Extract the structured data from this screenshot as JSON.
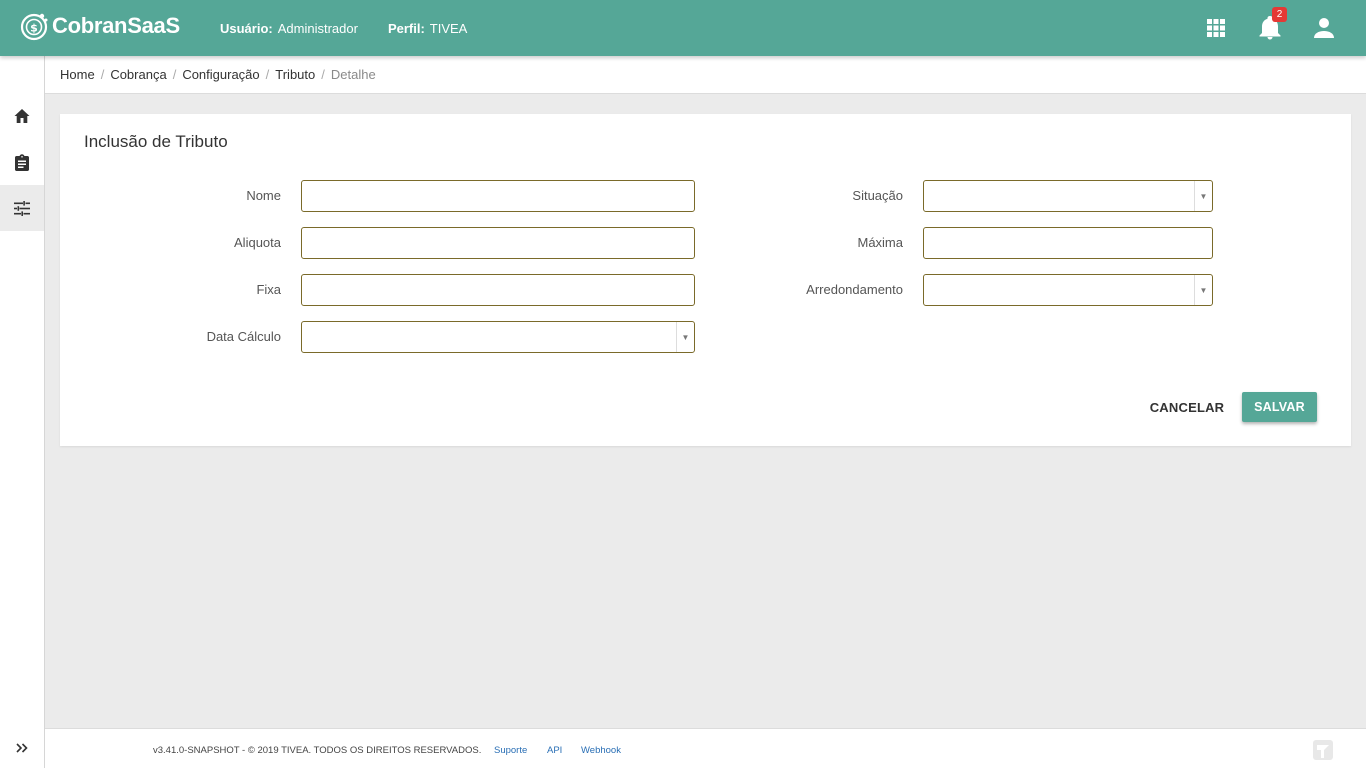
{
  "app": {
    "name": "CobranSaaS",
    "brand_color": "#55a797"
  },
  "header": {
    "user_label": "Usuário:",
    "user_value": "Administrador",
    "profile_label": "Perfil:",
    "profile_value": "TIVEA",
    "notification_count": "2"
  },
  "sidebar": {
    "items": [
      {
        "icon": "home-icon"
      },
      {
        "icon": "clipboard-icon"
      },
      {
        "icon": "sliders-icon",
        "active": true
      }
    ]
  },
  "breadcrumb": {
    "items": [
      "Home",
      "Cobrança",
      "Configuração",
      "Tributo"
    ],
    "current": "Detalhe"
  },
  "form": {
    "title": "Inclusão de Tributo",
    "fields": {
      "nome": {
        "label": "Nome",
        "value": ""
      },
      "aliquota": {
        "label": "Aliquota",
        "value": ""
      },
      "fixa": {
        "label": "Fixa",
        "value": ""
      },
      "data_calculo": {
        "label": "Data Cálculo",
        "value": ""
      },
      "situacao": {
        "label": "Situação",
        "value": ""
      },
      "maxima": {
        "label": "Máxima",
        "value": ""
      },
      "arredondamento": {
        "label": "Arredondamento",
        "value": ""
      }
    },
    "cancel_label": "CANCELAR",
    "save_label": "SALVAR"
  },
  "footer": {
    "text": "v3.41.0-SNAPSHOT - © 2019 TIVEA. TODOS OS DIREITOS RESERVADOS.",
    "links": [
      "Suporte",
      "API",
      "Webhook"
    ]
  }
}
